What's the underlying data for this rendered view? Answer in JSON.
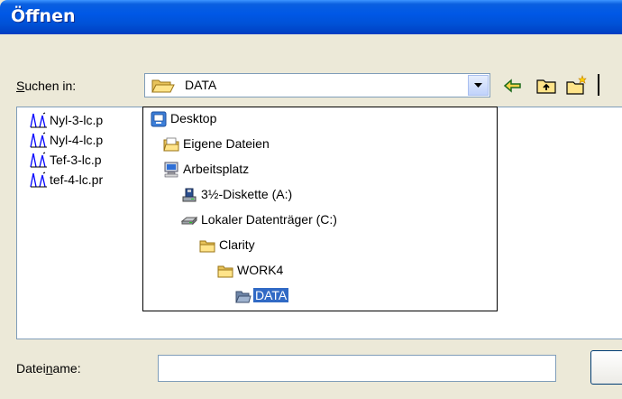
{
  "window": {
    "title": "Öffnen"
  },
  "lookin": {
    "label": "Suchen in:",
    "value": "DATA"
  },
  "toolbar": {
    "icons": [
      "back-arrow-icon",
      "up-folder-icon",
      "new-folder-icon"
    ]
  },
  "files": [
    {
      "name": "Nyl-3-lc.p"
    },
    {
      "name": "Nyl-4-lc.p"
    },
    {
      "name": "Tef-3-lc.p"
    },
    {
      "name": "tef-4-lc.pr"
    }
  ],
  "dropdown": {
    "items": [
      {
        "label": "Desktop",
        "icon": "desktop-icon"
      },
      {
        "label": "Eigene Dateien",
        "icon": "my-documents-icon"
      },
      {
        "label": "Arbeitsplatz",
        "icon": "my-computer-icon"
      },
      {
        "label": "3½-Diskette (A:)",
        "icon": "floppy-drive-icon"
      },
      {
        "label": "Lokaler Datenträger (C:)",
        "icon": "hard-drive-icon"
      },
      {
        "label": "Clarity",
        "icon": "folder-icon"
      },
      {
        "label": "WORK4",
        "icon": "folder-icon"
      },
      {
        "label": "DATA",
        "icon": "open-folder-icon",
        "selected": true
      }
    ]
  },
  "filename": {
    "label": "Dateiname:",
    "value": ""
  },
  "colors": {
    "titlebar": "#0054e3",
    "dialog_bg": "#ece9d8",
    "selection": "#316ac5"
  }
}
